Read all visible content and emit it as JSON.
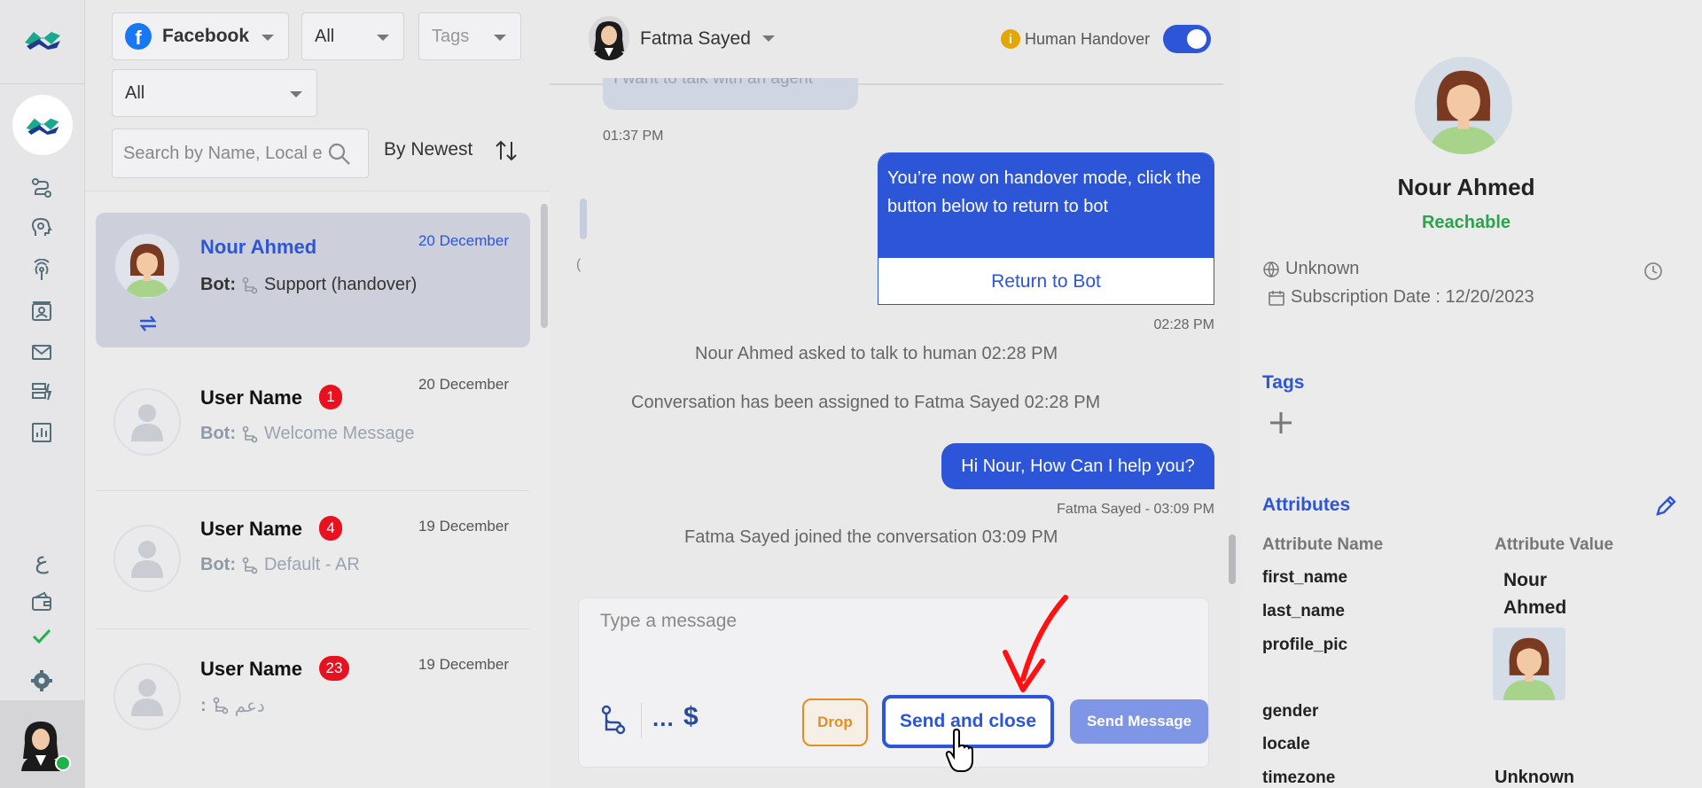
{
  "filters": {
    "channel": "Facebook",
    "status": "All",
    "tags_placeholder": "Tags",
    "assignee": "All",
    "search_placeholder": "Search by Name, Local e",
    "sort_label": "By Newest"
  },
  "conversations": [
    {
      "name": "Nour Ahmed",
      "date": "20 December",
      "bot_label": "Bot:",
      "flow": "Support (handover)",
      "active": true
    },
    {
      "name": "User Name",
      "date": "20 December",
      "badge": "1",
      "bot_label": "Bot:",
      "flow": "Welcome Message"
    },
    {
      "name": "User Name",
      "date": "19 December",
      "badge": "4",
      "bot_label": "Bot:",
      "flow": "Default - AR"
    },
    {
      "name": "User Name",
      "date": "19 December",
      "badge": "23",
      "bot_label": ":",
      "flow": "دعم"
    }
  ],
  "chat": {
    "agent_name": "Fatma Sayed",
    "handover_label": "Human Handover",
    "handover_on": true,
    "partial_message": "I want to talk with an agent",
    "time_1": "01:37 PM",
    "handover_message": "You’re now on handover mode, click the button below to return to bot",
    "return_button": "Return to Bot",
    "time_2": "02:28 PM",
    "sys_1_name": "Nour Ahmed",
    "sys_1_rest": "asked to talk to human 02:28 PM",
    "sys_2": "Conversation has been assigned to Fatma Sayed 02:28 PM",
    "outgoing": "Hi Nour, How Can I help you?",
    "outgoing_meta": "Fatma Sayed - 03:09 PM",
    "sys_3": "Fatma Sayed joined the conversation 03:09 PM",
    "composer_placeholder": "Type a message",
    "dots": "...",
    "dollar": "$",
    "drop_button": "Drop",
    "send_close_button": "Send and close",
    "send_button": "Send Message"
  },
  "details": {
    "name": "Nour Ahmed",
    "status": "Reachable",
    "location": "Unknown",
    "subscription": "Subscription Date : 12/20/2023",
    "tags_title": "Tags",
    "attributes_title": "Attributes",
    "attr_name_header": "Attribute Name",
    "attr_value_header": "Attribute Value",
    "attributes": [
      {
        "name": "first_name",
        "value": "Nour Ahmed"
      },
      {
        "name": "last_name",
        "value": ""
      },
      {
        "name": "profile_pic",
        "value": ""
      },
      {
        "name": "gender",
        "value": ""
      },
      {
        "name": "locale",
        "value": ""
      },
      {
        "name": "timezone",
        "value": "Unknown"
      }
    ]
  },
  "rail": {
    "arabic_label": "ع"
  },
  "colors": {
    "accent": "#2c55d8",
    "success": "#2aa34a",
    "badge": "#e8111f",
    "warning": "#e28f22"
  }
}
